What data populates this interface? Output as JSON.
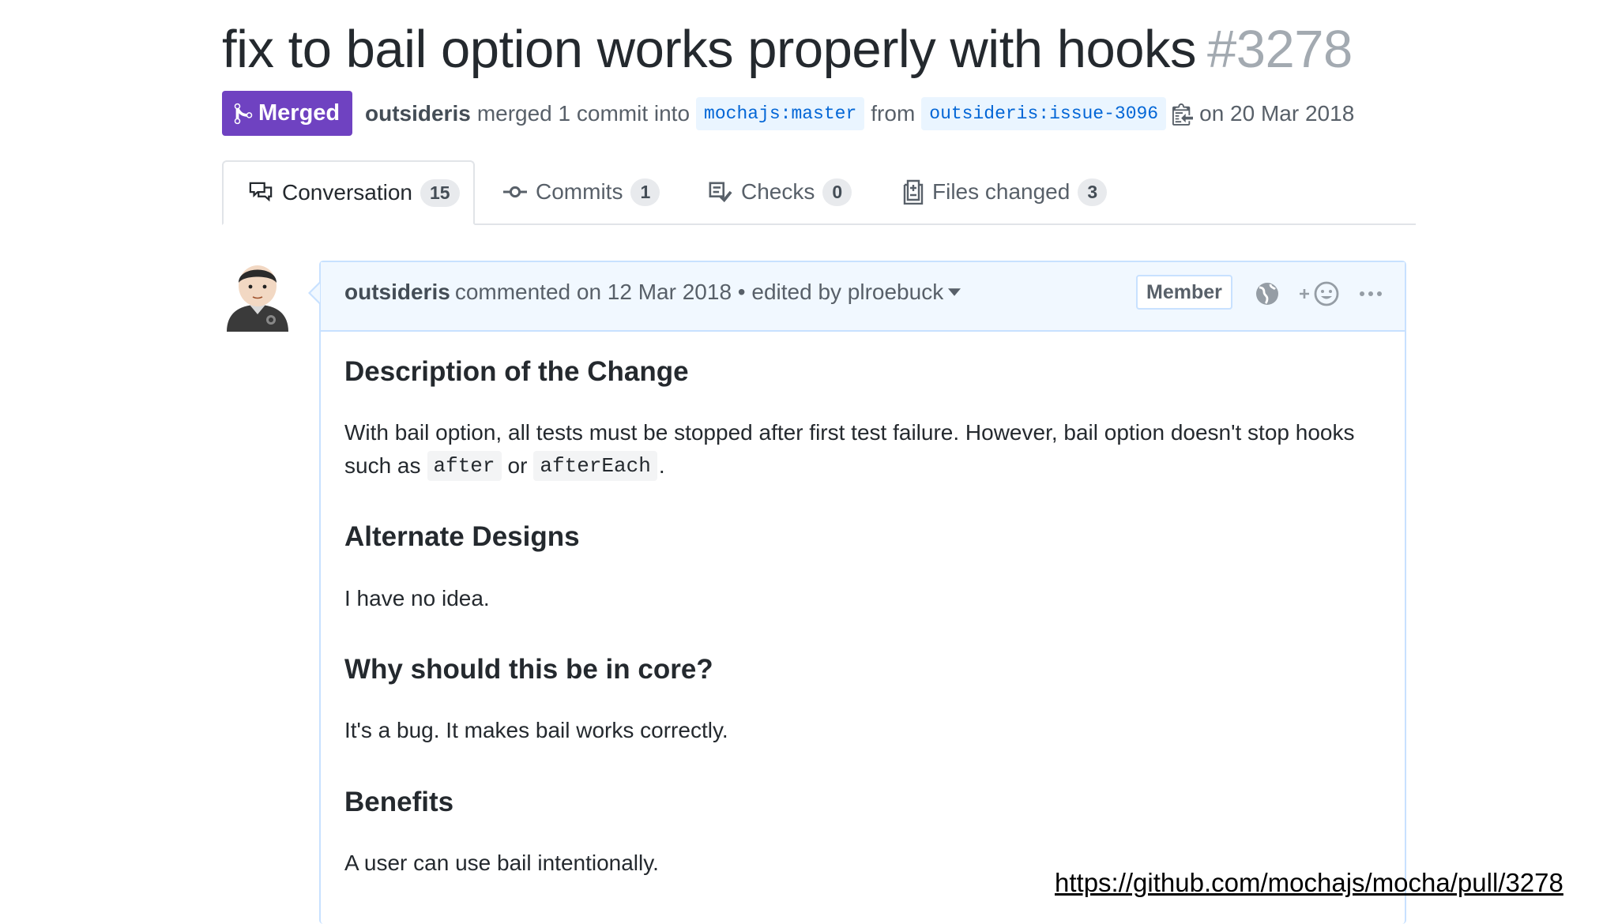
{
  "pr": {
    "title": "fix to bail option works properly with hooks",
    "number": "#3278",
    "status_label": "Merged",
    "author": "outsideris",
    "merge_text": "merged 1 commit into",
    "base_branch": "mochajs:master",
    "from_text": "from",
    "head_branch": "outsideris:issue-3096",
    "date_text": "on 20 Mar 2018"
  },
  "tabs": [
    {
      "label": "Conversation",
      "count": "15"
    },
    {
      "label": "Commits",
      "count": "1"
    },
    {
      "label": "Checks",
      "count": "0"
    },
    {
      "label": "Files changed",
      "count": "3"
    }
  ],
  "comment": {
    "author": "outsideris",
    "meta_text": "commented on 12 Mar 2018 • edited by plroebuck",
    "author_badge": "Member",
    "sections": {
      "desc_heading": "Description of the Change",
      "desc_line1": "With bail option, all tests must be stopped after first test failure. However, bail option doesn't stop hooks",
      "desc_line2_prefix": "such as",
      "desc_code1": "after",
      "desc_or": "or",
      "desc_code2": "afterEach",
      "desc_period": ".",
      "alt_heading": "Alternate Designs",
      "alt_text": "I have no idea.",
      "why_heading": "Why should this be in core?",
      "why_text": "It's a bug. It makes bail works correctly.",
      "benefits_heading": "Benefits",
      "benefits_text": "A user can use bail intentionally."
    }
  },
  "source_url": "https://github.com/mochajs/mocha/pull/3278",
  "colors": {
    "merged": "#6f42c1",
    "branch_bg": "#eaf5ff",
    "branch_fg": "#0366d6",
    "comment_header_bg": "#f1f8ff",
    "comment_border": "#c8e1ff"
  },
  "icons": [
    "git-merge-icon",
    "clipboard-icon",
    "comment-discussion-icon",
    "git-commit-icon",
    "checklist-icon",
    "file-diff-icon",
    "chevron-down-icon",
    "globe-icon",
    "add-reaction-icon",
    "kebab-horizontal-icon",
    "avatar"
  ]
}
